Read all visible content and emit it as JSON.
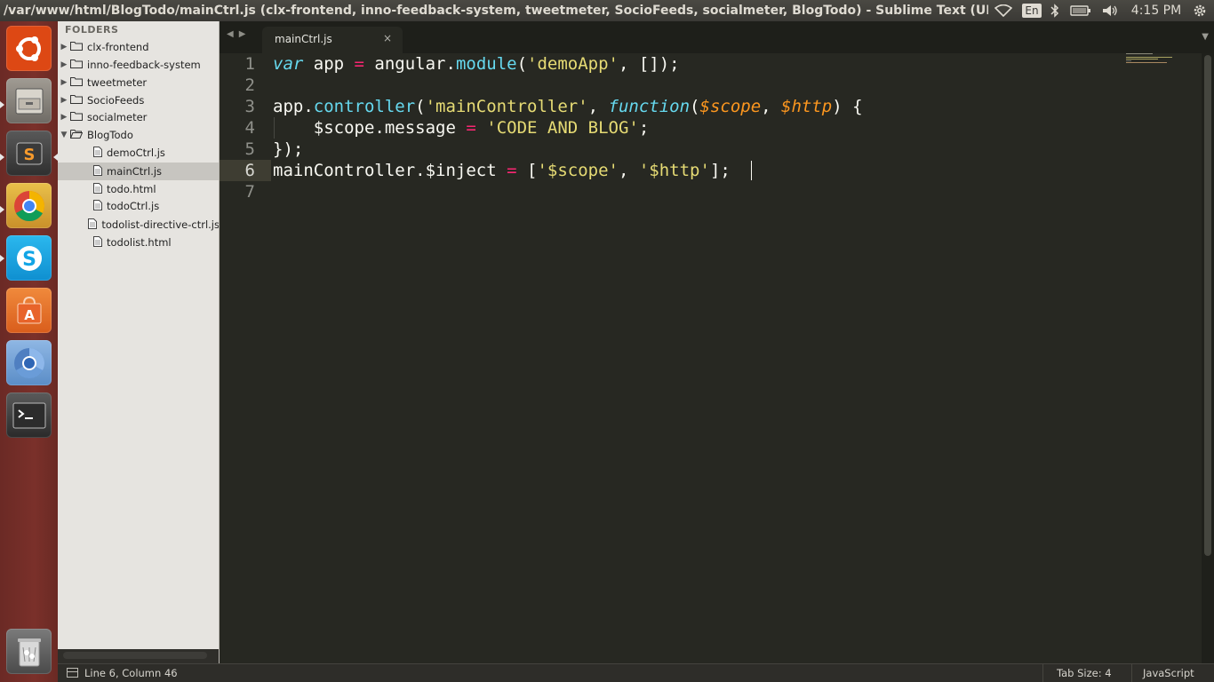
{
  "window": {
    "title": "/var/www/html/BlogTodo/mainCtrl.js (clx-frontend, inno-feedback-system, tweetmeter, SocioFeeds, socialmeter, BlogTodo) - Sublime Text (UNREGISTERED)"
  },
  "tray": {
    "language": "En",
    "clock": "4:15 PM",
    "icons": [
      "wifi-icon",
      "bluetooth-icon",
      "battery-icon",
      "volume-icon",
      "settings-gear-icon"
    ]
  },
  "launcher": {
    "items": [
      {
        "name": "ubuntu-dash-icon",
        "color": "#dd4814"
      },
      {
        "name": "files-icon",
        "color": "#8f8b84"
      },
      {
        "name": "sublime-text-icon",
        "color": "#4b4b4b"
      },
      {
        "name": "chrome-icon",
        "color": "#e6b23a"
      },
      {
        "name": "skype-icon",
        "color": "#12a5e6"
      },
      {
        "name": "software-center-icon",
        "color": "#e7702b"
      },
      {
        "name": "chromium-icon",
        "color": "#6fa3d9"
      },
      {
        "name": "terminal-icon",
        "color": "#2c2c2c"
      },
      {
        "name": "trash-icon",
        "color": "#8d8d8d"
      }
    ]
  },
  "sidebar": {
    "heading": "FOLDERS",
    "folders": [
      {
        "label": "clx-frontend"
      },
      {
        "label": "inno-feedback-system"
      },
      {
        "label": "tweetmeter"
      },
      {
        "label": "SocioFeeds"
      },
      {
        "label": "socialmeter"
      },
      {
        "label": "BlogTodo"
      }
    ],
    "files": [
      {
        "label": "demoCtrl.js"
      },
      {
        "label": "mainCtrl.js"
      },
      {
        "label": "todo.html"
      },
      {
        "label": "todoCtrl.js"
      },
      {
        "label": "todolist-directive-ctrl.js"
      },
      {
        "label": "todolist.html"
      }
    ],
    "selected_file": "mainCtrl.js"
  },
  "tabs": {
    "active_label": "mainCtrl.js",
    "close_glyph": "×"
  },
  "editor": {
    "line_numbers": [
      "1",
      "2",
      "3",
      "4",
      "5",
      "6",
      "7"
    ],
    "current_line": "6",
    "lines": [
      "var app = angular.module('demoApp', []);",
      "",
      "app.controller('mainController', function($scope, $http) {",
      "    $scope.message = 'CODE AND BLOG';",
      "});",
      "mainController.$inject = ['$scope', '$http'];",
      ""
    ],
    "tokens": {
      "l1": [
        "var",
        " app ",
        "=",
        " angular.",
        "module",
        "(",
        "'demoApp'",
        ", []);"
      ],
      "l3": [
        "app.",
        "controller",
        "(",
        "'mainController'",
        ", ",
        "function",
        "(",
        "$scope",
        ", ",
        "$http",
        ") {"
      ],
      "l4": [
        "    $scope.message ",
        "=",
        " ",
        "'CODE AND BLOG'",
        ";"
      ],
      "l5": [
        "});"
      ],
      "l6": [
        "mainController.$inject ",
        "=",
        " [",
        "'$scope'",
        ", ",
        "'$http'",
        "];"
      ]
    }
  },
  "status": {
    "position": "Line 6, Column 46",
    "tab_size": "Tab Size: 4",
    "syntax": "JavaScript"
  },
  "colors": {
    "editor_bg": "#272822",
    "keyword": "#66d9ef",
    "string": "#e6db74",
    "operator": "#f92672",
    "parameter": "#fd971f",
    "text": "#f8f8f2",
    "launcher_bg": "#7a302a"
  }
}
